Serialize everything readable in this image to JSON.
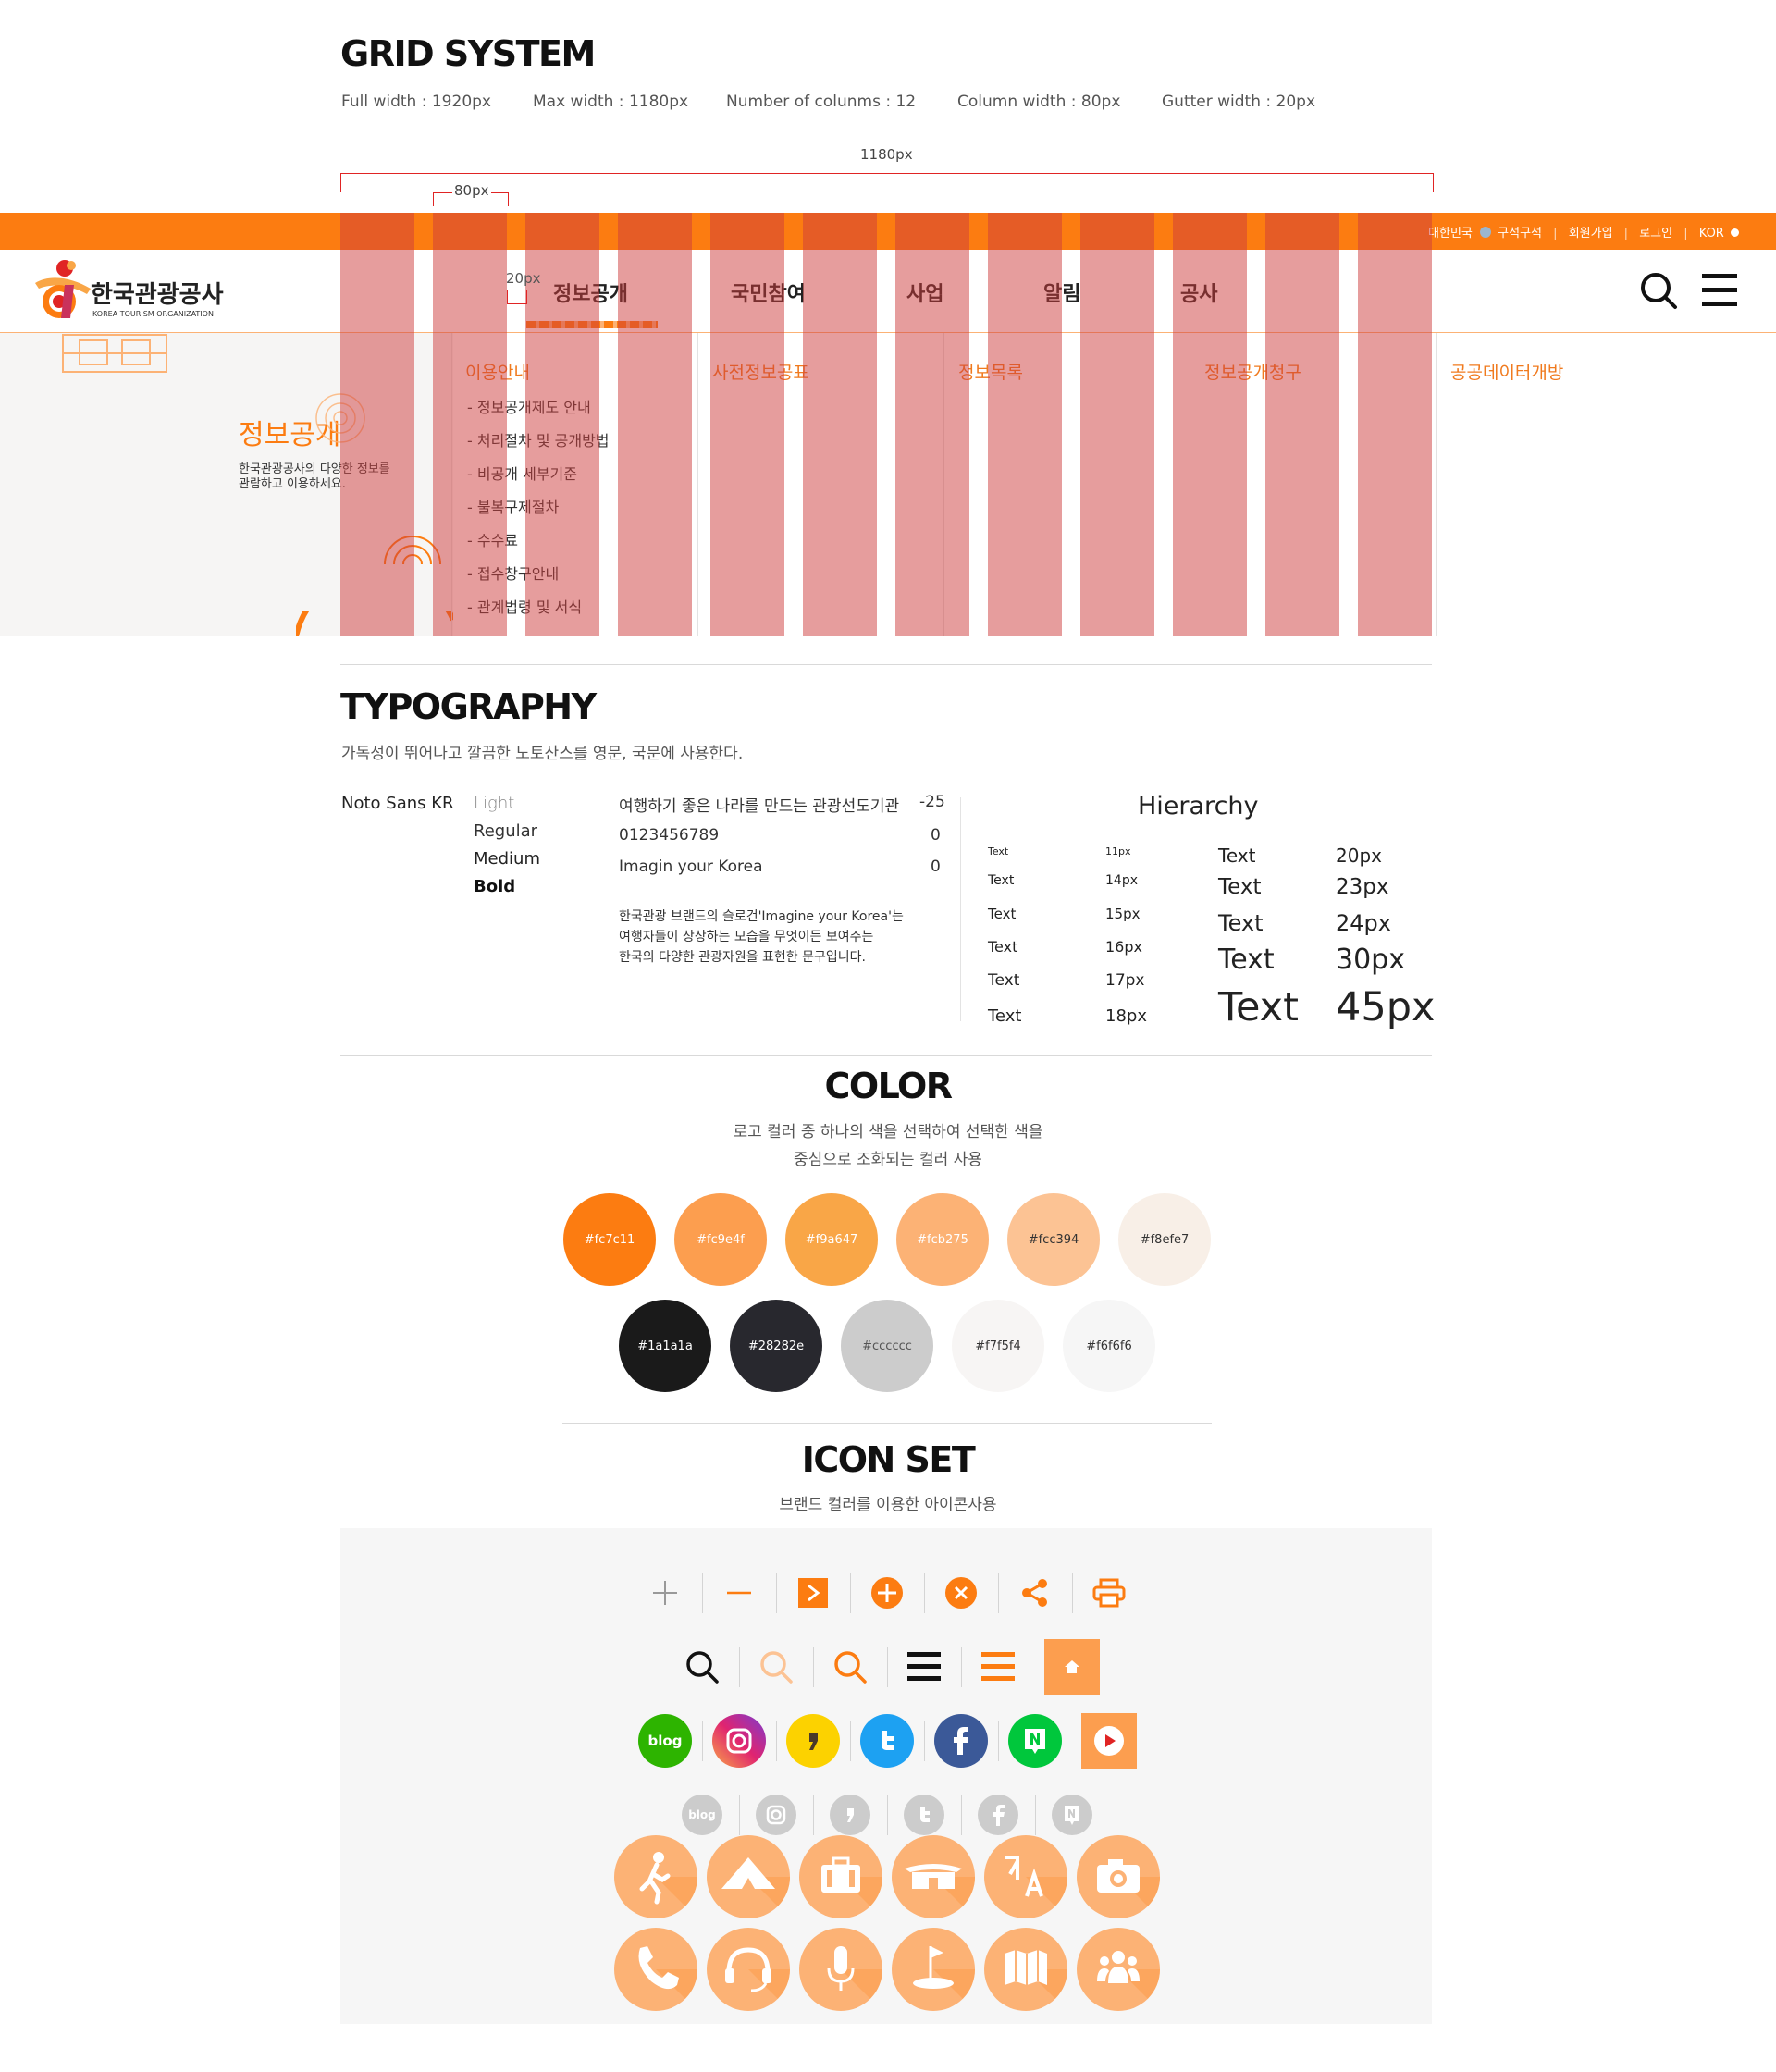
{
  "grid": {
    "title": "GRID SYSTEM",
    "specs": [
      "Full width : 1920px",
      "Max width : 1180px",
      "Number of colunms : 12",
      "Column width : 80px",
      "Gutter width : 20px"
    ],
    "dim_total": "1180px",
    "dim_column": "80px",
    "dim_gutter": "20px"
  },
  "header": {
    "top_links": [
      "대한민국",
      "구석구석",
      "회원가입",
      "로그인",
      "KOR"
    ],
    "logo_name": "한국관광공사",
    "logo_sub": "KOREA TOURISM ORGANIZATION",
    "nav": [
      "정보공개",
      "국민참여",
      "사업",
      "알림",
      "공사"
    ]
  },
  "megamenu": {
    "section_title": "정보공개",
    "section_desc_1": "한국관광공사의 다양한 정보를",
    "section_desc_2": "관람하고 이용하세요.",
    "col1_head": "이용안내",
    "col1_items": [
      "- 정보공개제도 안내",
      "- 처리절차 및 공개방법",
      "- 비공개 세부기준",
      "- 불복구제절차",
      "- 수수료",
      "- 접수창구안내",
      "- 관계법령 및 서식"
    ],
    "col2_head": "사전정보공표",
    "col3_head": "정보목록",
    "col4_head": "정보공개청구",
    "col5_head": "공공데이터개방"
  },
  "typography": {
    "title": "TYPOGRAPHY",
    "desc": "가독성이 뛰어나고 깔끔한 노토산스를 영문, 국문에 사용한다.",
    "font_name": "Noto Sans KR",
    "weights": [
      "Light",
      "Regular",
      "Medium",
      "Bold"
    ],
    "samples": [
      {
        "text": "여행하기 좋은 나라를 만드는 관광선도기관",
        "tracking": "-25"
      },
      {
        "text": "0123456789",
        "tracking": "0"
      },
      {
        "text": "Imagin your Korea",
        "tracking": "0"
      }
    ],
    "paragraph": [
      "한국관광 브랜드의 슬로건'Imagine your Korea'는",
      "여행자들이 상상하는 모습을 무엇이든 보여주는",
      "한국의 다양한 관광자원을 표현한 문구입니다."
    ],
    "hierarchy_title": "Hierarchy",
    "hierarchy_left": [
      {
        "label": "Text",
        "size": "11px"
      },
      {
        "label": "Text",
        "size": "14px"
      },
      {
        "label": "Text",
        "size": "15px"
      },
      {
        "label": "Text",
        "size": "16px"
      },
      {
        "label": "Text",
        "size": "17px"
      },
      {
        "label": "Text",
        "size": "18px"
      }
    ],
    "hierarchy_right": [
      {
        "label": "Text",
        "size": "20px"
      },
      {
        "label": "Text",
        "size": "23px"
      },
      {
        "label": "Text",
        "size": "24px"
      },
      {
        "label": "Text",
        "size": "30px"
      },
      {
        "label": "Text",
        "size": "45px"
      }
    ]
  },
  "color": {
    "title": "COLOR",
    "desc_1": "로고 컬러 중 하나의 색을 선택하여 선택한 색을",
    "desc_2": "중심으로 조화되는 컬러 사용",
    "row1": [
      {
        "hex": "#fc7c11",
        "label": "#fc7c11"
      },
      {
        "hex": "#fc9e4f",
        "label": "#fc9e4f"
      },
      {
        "hex": "#f9a647",
        "label": "#f9a647"
      },
      {
        "hex": "#fcb275",
        "label": "#fcb275"
      },
      {
        "hex": "#fcc394",
        "label": "#fcc394"
      },
      {
        "hex": "#f8efe7",
        "label": "#f8efe7"
      }
    ],
    "row2": [
      {
        "hex": "#1a1a1a",
        "label": "#1a1a1a"
      },
      {
        "hex": "#28282e",
        "label": "#28282e"
      },
      {
        "hex": "#cccccc",
        "label": "#cccccc"
      },
      {
        "hex": "#f7f5f4",
        "label": "#f7f5f4"
      },
      {
        "hex": "#f6f6f6",
        "label": "#f6f6f6"
      }
    ]
  },
  "icons": {
    "title": "ICON SET",
    "desc": "브랜드 컬러를 이용한 아이콘사용",
    "brand_label": "blog",
    "row1": [
      "plus-icon",
      "minus-icon",
      "next-arrow-icon",
      "add-circle-icon",
      "close-circle-icon",
      "share-icon",
      "print-icon"
    ],
    "row2": [
      "search-icon-black",
      "search-icon-light",
      "search-icon-orange",
      "menu-icon-black",
      "menu-icon-orange",
      "home-icon"
    ],
    "row3": [
      "blog-icon",
      "instagram-icon",
      "kakao-story-icon",
      "twitter-icon",
      "facebook-icon",
      "naver-band-icon",
      "youtube-icon"
    ],
    "row4": [
      "blog-gray-icon",
      "instagram-gray-icon",
      "kakao-gray-icon",
      "twitter-gray-icon",
      "facebook-gray-icon",
      "band-gray-icon"
    ],
    "row5": [
      "walking-icon",
      "camping-icon",
      "luggage-icon",
      "tent-icon",
      "language-icon",
      "camera-icon"
    ],
    "row6": [
      "phone-icon",
      "headset-icon",
      "microphone-icon",
      "golf-icon",
      "map-icon",
      "group-icon"
    ]
  }
}
